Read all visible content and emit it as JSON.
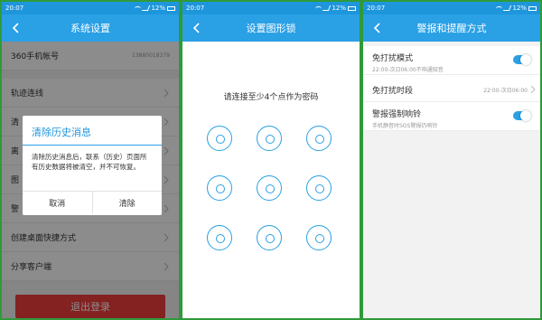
{
  "colors": {
    "accent": "#2aa0e5",
    "status": "#1e96dc",
    "danger": "#f03c3c",
    "frame": "#2f9a3a"
  },
  "panel1": {
    "status_time": "20:07",
    "status_battery": "12%",
    "title": "系统设置",
    "account": {
      "label": "360手机帐号",
      "value": "13880018379"
    },
    "rows": [
      "轨迹连线",
      "清",
      "离",
      "图",
      "警",
      "创建桌面快捷方式",
      "分享客户端"
    ],
    "logout_label": "退出登录",
    "dialog": {
      "title": "清除历史消息",
      "message": "清除历史消息后，联系（历史）页面所有历史数据将被清空，并不可恢复。",
      "cancel": "取消",
      "confirm": "清除"
    }
  },
  "panel2": {
    "status_time": "20:07",
    "status_battery": "12%",
    "title": "设置图形锁",
    "prompt": "请连接至少4个点作为密码"
  },
  "panel3": {
    "status_time": "20:07",
    "status_battery": "12%",
    "title": "警报和提醒方式",
    "items": [
      {
        "title": "免打扰模式",
        "subtitle": "22:00-次日06:00不响通知音",
        "control": "toggle",
        "on": true
      },
      {
        "title": "免打扰时段",
        "value": "22:00-次日06:00",
        "control": "chevron"
      },
      {
        "title": "警报强制响铃",
        "subtitle": "手机静音时SOS警报仍响铃",
        "control": "toggle",
        "on": true
      }
    ]
  }
}
